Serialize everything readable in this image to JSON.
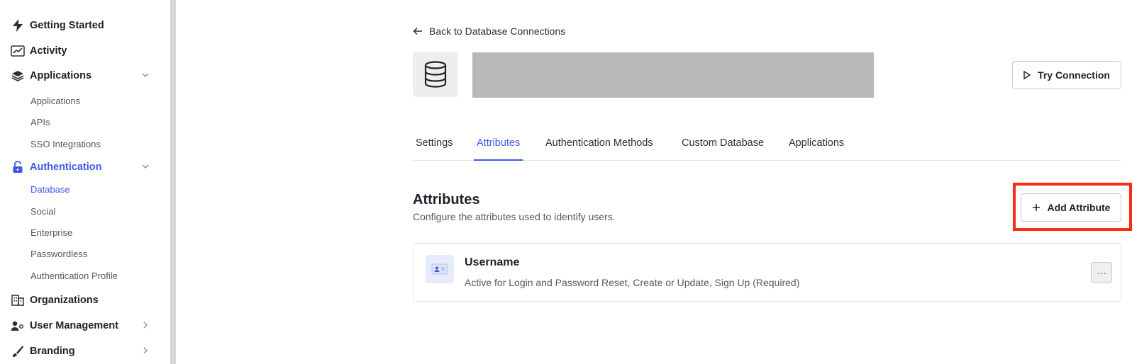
{
  "sidebar": {
    "items": [
      {
        "label": "Getting Started",
        "icon": "lightning-icon"
      },
      {
        "label": "Activity",
        "icon": "trend-chart-icon"
      },
      {
        "label": "Applications",
        "icon": "layers-icon"
      },
      {
        "label": "Authentication",
        "icon": "lock-icon"
      },
      {
        "label": "Organizations",
        "icon": "building-icon"
      },
      {
        "label": "User Management",
        "icon": "users-icon"
      },
      {
        "label": "Branding",
        "icon": "brush-icon"
      }
    ],
    "applications_sub": [
      "Applications",
      "APIs",
      "SSO Integrations"
    ],
    "authentication_sub": [
      "Database",
      "Social",
      "Enterprise",
      "Passwordless",
      "Authentication Profile"
    ]
  },
  "header": {
    "back_label": "Back to Database Connections",
    "try_button": "Try Connection"
  },
  "tabs": [
    "Settings",
    "Attributes",
    "Authentication Methods",
    "Custom Database",
    "Applications"
  ],
  "active_tab": "Attributes",
  "section": {
    "title": "Attributes",
    "description": "Configure the attributes used to identify users.",
    "add_button": "Add Attribute"
  },
  "attributes": [
    {
      "name": "Username",
      "description": "Active for Login and Password Reset, Create or Update, Sign Up (Required)",
      "menu": "···"
    }
  ],
  "colors": {
    "accent": "#3f59e4",
    "highlight": "#ff2a12",
    "redaction": "#b8b8b8"
  }
}
